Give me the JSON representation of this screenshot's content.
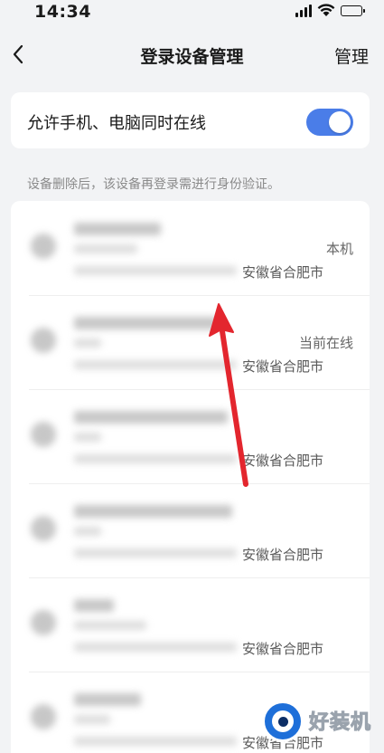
{
  "status_bar": {
    "time": "14:34"
  },
  "nav": {
    "title": "登录设备管理",
    "action": "管理"
  },
  "toggle": {
    "label": "允许手机、电脑同时在线",
    "state": "on",
    "color": "#4a7de8"
  },
  "hint": "设备删除后，该设备再登录需进行身份验证。",
  "devices": [
    {
      "location": "安徽省合肥市",
      "status": "本机"
    },
    {
      "location": "安徽省合肥市",
      "status": "当前在线"
    },
    {
      "location": "安徽省合肥市",
      "status": ""
    },
    {
      "location": "安徽省合肥市",
      "status": ""
    },
    {
      "location": "安徽省合肥市",
      "status": ""
    },
    {
      "location": "安徽省合肥市",
      "status": ""
    }
  ],
  "watermark": {
    "text": "好装机"
  },
  "colors": {
    "background": "#f2f3f5",
    "annotation_arrow": "#e3262e"
  },
  "icons": {
    "back": "chevron-left-icon",
    "signal": "cellular-signal-icon",
    "wifi": "wifi-icon",
    "battery": "battery-charging-icon"
  }
}
